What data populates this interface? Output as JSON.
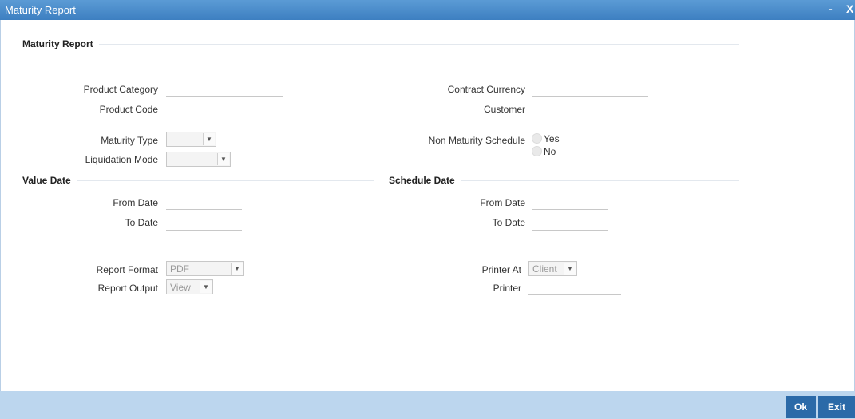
{
  "window": {
    "title": "Maturity Report",
    "minimize": "-",
    "close": "X"
  },
  "main": {
    "section_title": "Maturity Report",
    "product_category_label": "Product Category",
    "product_category_value": "",
    "product_code_label": "Product Code",
    "product_code_value": "",
    "maturity_type_label": "Maturity Type",
    "maturity_type_value": "",
    "liquidation_mode_label": "Liquidation Mode",
    "liquidation_mode_value": "",
    "contract_currency_label": "Contract Currency",
    "contract_currency_value": "",
    "customer_label": "Customer",
    "customer_value": "",
    "non_maturity_schedule_label": "Non Maturity Schedule",
    "non_maturity_options": [
      "Yes",
      "No"
    ]
  },
  "value_date": {
    "title": "Value Date",
    "from_label": "From Date",
    "from_value": "",
    "to_label": "To Date",
    "to_value": ""
  },
  "schedule_date": {
    "title": "Schedule Date",
    "from_label": "From Date",
    "from_value": "",
    "to_label": "To Date",
    "to_value": ""
  },
  "report": {
    "format_label": "Report Format",
    "format_value": "PDF",
    "output_label": "Report Output",
    "output_value": "View",
    "printer_at_label": "Printer At",
    "printer_at_value": "Client",
    "printer_label": "Printer",
    "printer_value": ""
  },
  "footer": {
    "ok_label": "Ok",
    "exit_label": "Exit"
  },
  "colors": {
    "titlebar": "#3d7fc1",
    "footer": "#bcd6ee",
    "button": "#2b6aa8"
  }
}
